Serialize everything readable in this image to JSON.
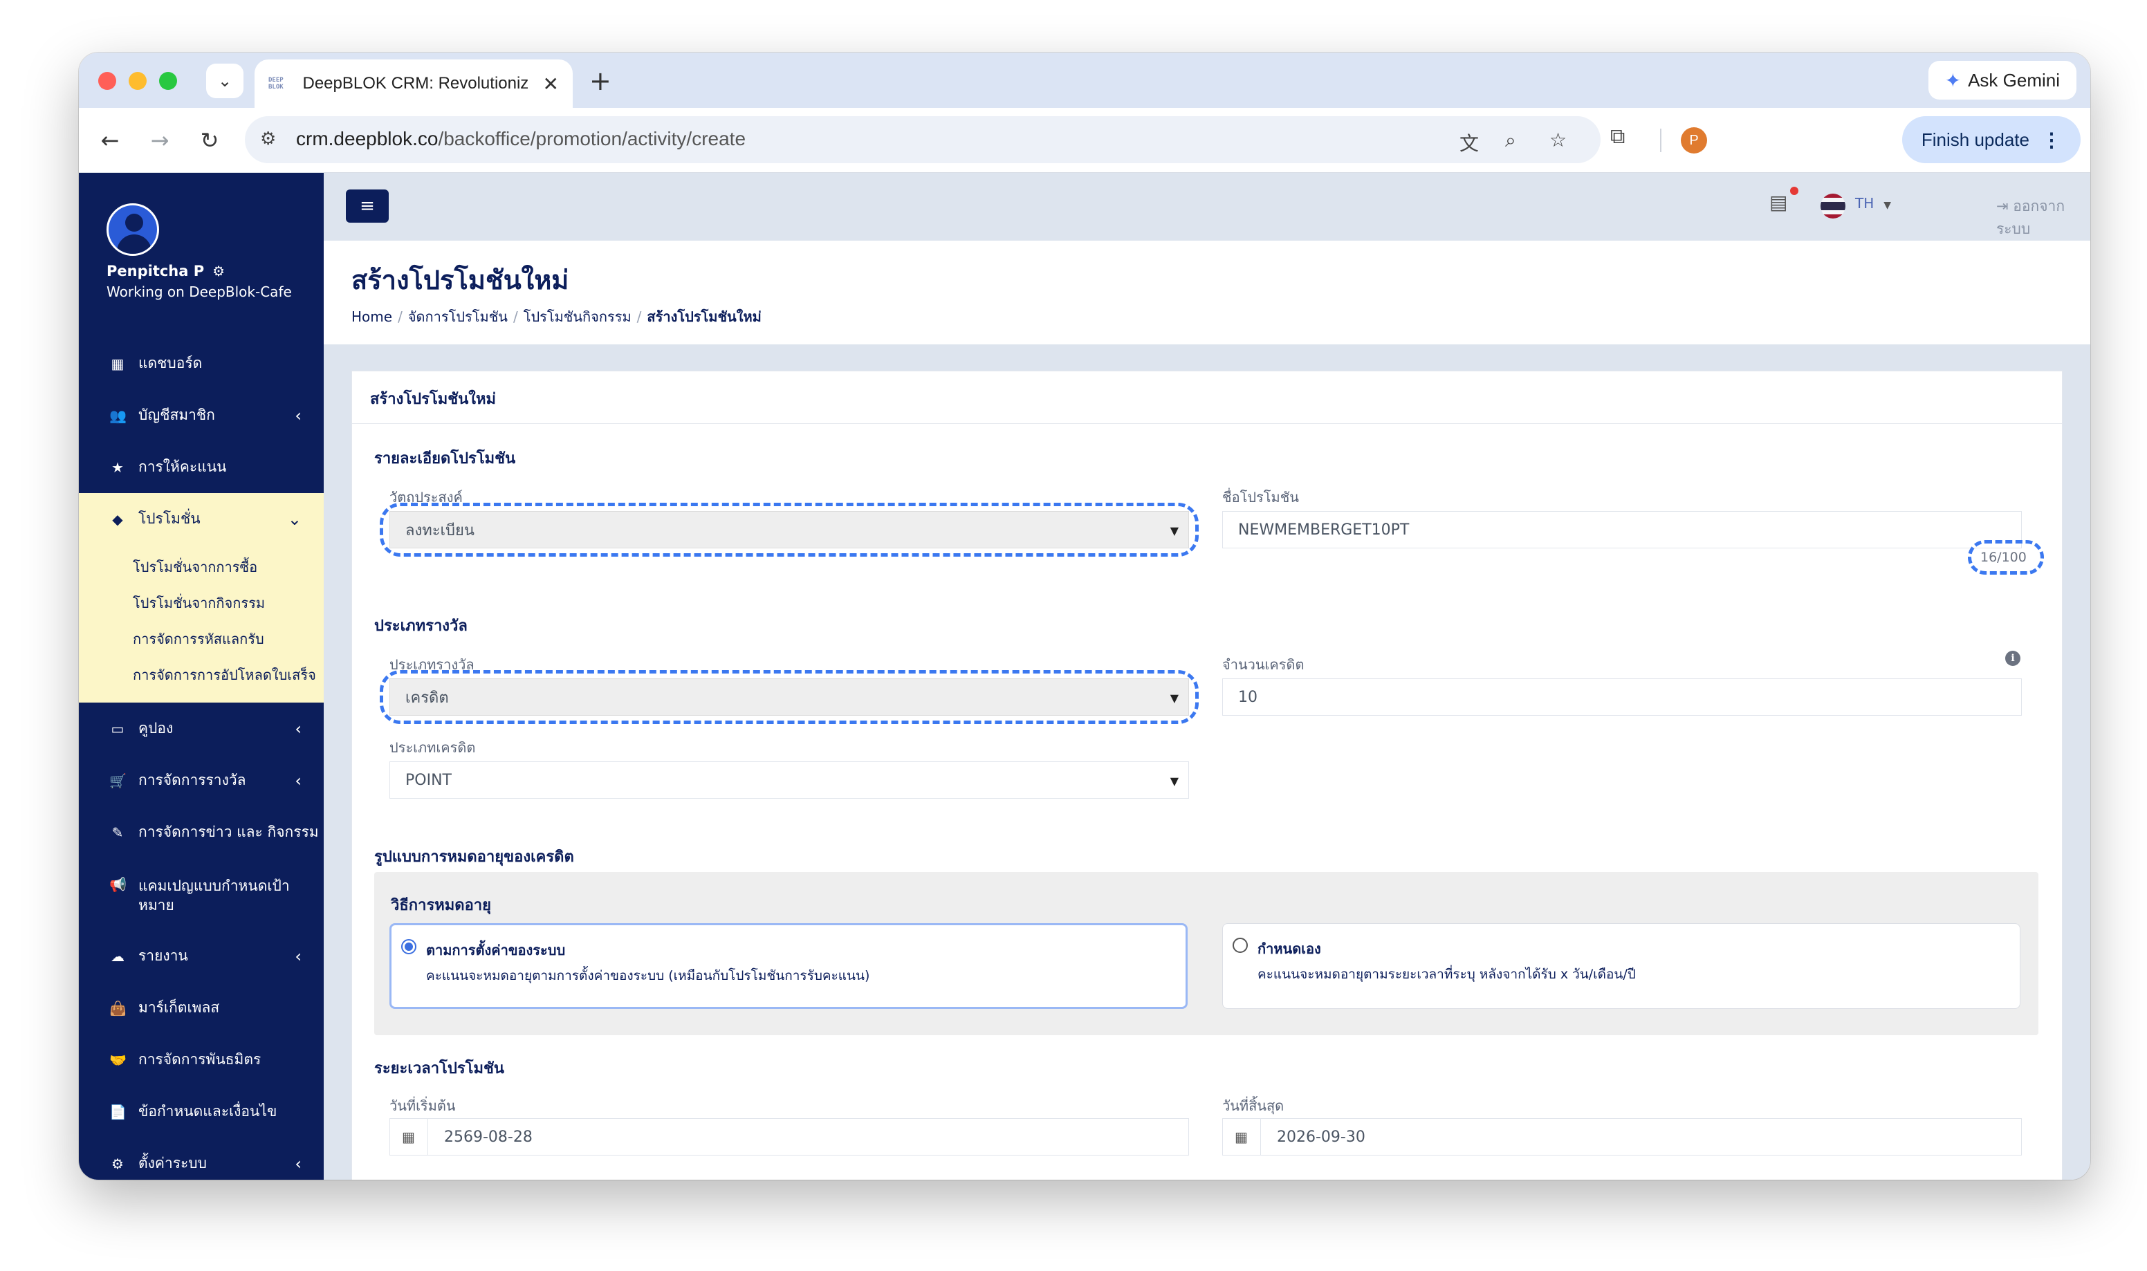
{
  "browser": {
    "tab_title": "DeepBLOK CRM: Revolutioniz",
    "favicon_text": [
      "DEEP",
      "BLOK"
    ],
    "new_tab_symbol": "+",
    "ask_gemini_label": "Ask Gemini",
    "url_host": "crm.deepblok.co",
    "url_path": "/backoffice/promotion/activity/create",
    "profile_initial": "P",
    "finish_update_label": "Finish update"
  },
  "sidebar": {
    "user_name": "Penpitcha P",
    "working_on": "Working on DeepBlok-Cafe",
    "items": [
      {
        "label": "แดชบอร์ด",
        "icon": "dashboard-icon"
      },
      {
        "label": "บัญชีสมาชิก",
        "icon": "users-icon"
      },
      {
        "label": "การให้คะแนน",
        "icon": "star-icon"
      },
      {
        "label": "โปรโมชั่น",
        "icon": "tag-icon"
      },
      {
        "label": "คูปอง",
        "icon": "ticket-icon"
      },
      {
        "label": "การจัดการรางวัล",
        "icon": "cart-icon"
      },
      {
        "label": "การจัดการข่าว และ กิจกรรม",
        "icon": "edit-icon"
      },
      {
        "label": "แคมเปญแบบกำหนดเป้าหมาย",
        "icon": "megaphone-icon"
      },
      {
        "label": "รายงาน",
        "icon": "cloud-icon"
      },
      {
        "label": "มาร์เก็ตเพลส",
        "icon": "bag-icon"
      },
      {
        "label": "การจัดการพันธมิตร",
        "icon": "handshake-icon"
      },
      {
        "label": "ข้อกำหนดและเงื่อนไข",
        "icon": "document-icon"
      },
      {
        "label": "ตั้งค่าระบบ",
        "icon": "gear-icon"
      }
    ],
    "promotion_submenu": [
      "โปรโมชั่นจากการซื้อ",
      "โปรโมชั่นจากกิจกรรม",
      "การจัดการรหัสแลกรับ",
      "การจัดการการอัปโหลดใบเสร็จ"
    ]
  },
  "topbar": {
    "language": "TH",
    "logout_label": "ออกจากระบบ"
  },
  "header": {
    "title": "สร้างโปรโมชันใหม่",
    "breadcrumb": [
      "Home",
      "จัดการโปรโมชัน",
      "โปรโมชันกิจกรรม",
      "สร้างโปรโมชันใหม่"
    ]
  },
  "form": {
    "card_title": "สร้างโปรโมชันใหม่",
    "details_section": "รายละเอียดโปรโมชัน",
    "objective_label": "วัตถุประสงค์",
    "objective_value": "ลงทะเบียน",
    "promo_name_label": "ชื่อโปรโมชัน",
    "promo_name_value": "NEWMEMBERGET10PT",
    "promo_name_counter": "16/100",
    "reward_section": "ประเภทรางวัล",
    "reward_type_label": "ประเภทรางวัล",
    "reward_type_value": "เครดิต",
    "credit_amount_label": "จำนวนเครดิต",
    "credit_amount_value": "10",
    "credit_type_label": "ประเภทเครดิต",
    "credit_type_value": "POINT",
    "expiry_section": "รูปแบบการหมดอายุของเครดิต",
    "expiry_method_label": "วิธีการหมดอายุ",
    "expiry_options": [
      {
        "title": "ตามการตั้งค่าของระบบ",
        "desc": "คะแนนจะหมดอายุตามการตั้งค่าของระบบ (เหมือนกับโปรโมชันการรับคะแนน)",
        "selected": true
      },
      {
        "title": "กำหนดเอง",
        "desc": "คะแนนจะหมดอายุตามระยะเวลาที่ระบุ หลังจากได้รับ x วัน/เดือน/ปี",
        "selected": false
      }
    ],
    "period_section": "ระยะเวลาโปรโมชัน",
    "start_date_label": "วันที่เริ่มต้น",
    "start_date_value": "2569-08-28",
    "end_date_label": "วันที่สิ้นสุด",
    "end_date_value": "2026-09-30"
  },
  "colors": {
    "sidebar_bg": "#0c1e5b",
    "active_menu_bg": "#fcf6c8",
    "highlight_dash": "#3b78f0",
    "finish_update_bg": "#d3e3fd"
  }
}
